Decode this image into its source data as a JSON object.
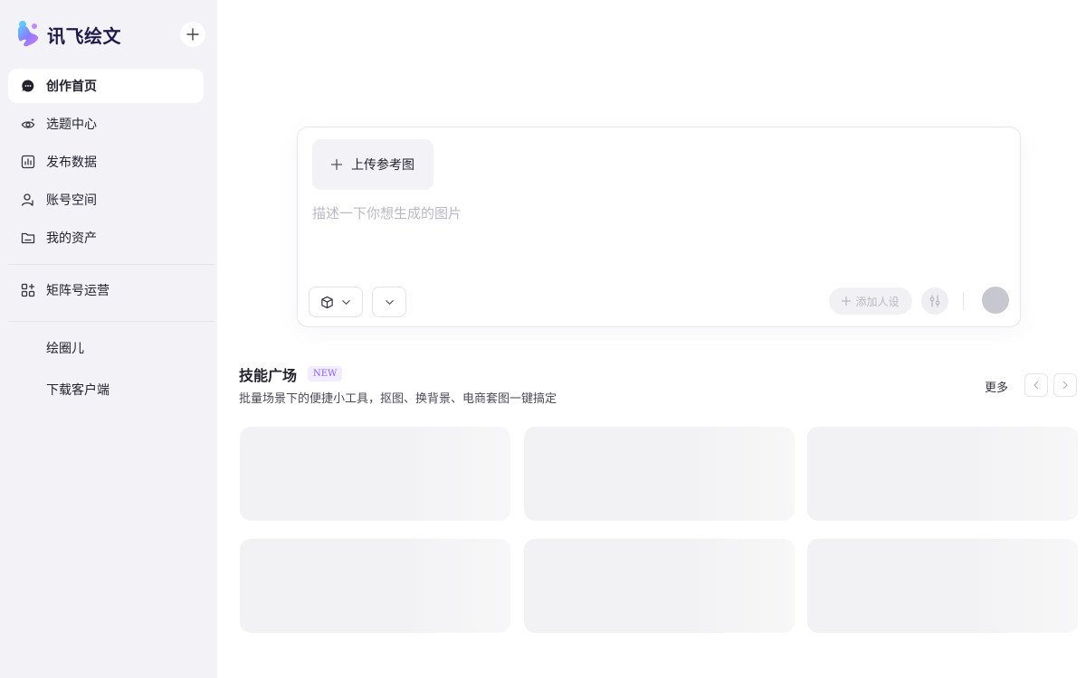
{
  "brand": {
    "name": "讯飞绘文"
  },
  "nav": {
    "items": [
      {
        "label": "创作首页",
        "icon": "chat-bubble-icon",
        "active": true
      },
      {
        "label": "选题中心",
        "icon": "eye-sparkle-icon",
        "active": false
      },
      {
        "label": "发布数据",
        "icon": "bar-chart-icon",
        "active": false
      },
      {
        "label": "账号空间",
        "icon": "user-icon",
        "active": false
      },
      {
        "label": "我的资产",
        "icon": "folder-icon",
        "active": false
      }
    ],
    "matrix": {
      "label": "矩阵号运营",
      "icon": "grid-plus-icon"
    },
    "extra": [
      "绘圈儿",
      "下载客户端"
    ]
  },
  "composer": {
    "upload_label": "上传参考图",
    "prompt_placeholder": "描述一下你想生成的图片",
    "persona_label": "添加人设"
  },
  "skills": {
    "title": "技能广场",
    "badge": "NEW",
    "subtitle": "批量场景下的便捷小工具，抠图、换背景、电商套图一键搞定",
    "more_label": "更多"
  },
  "colors": {
    "sidebar_bg": "#f2f2f7",
    "accent_purple": "#8b5cf6",
    "placeholder_card": "#f2f2f4"
  }
}
